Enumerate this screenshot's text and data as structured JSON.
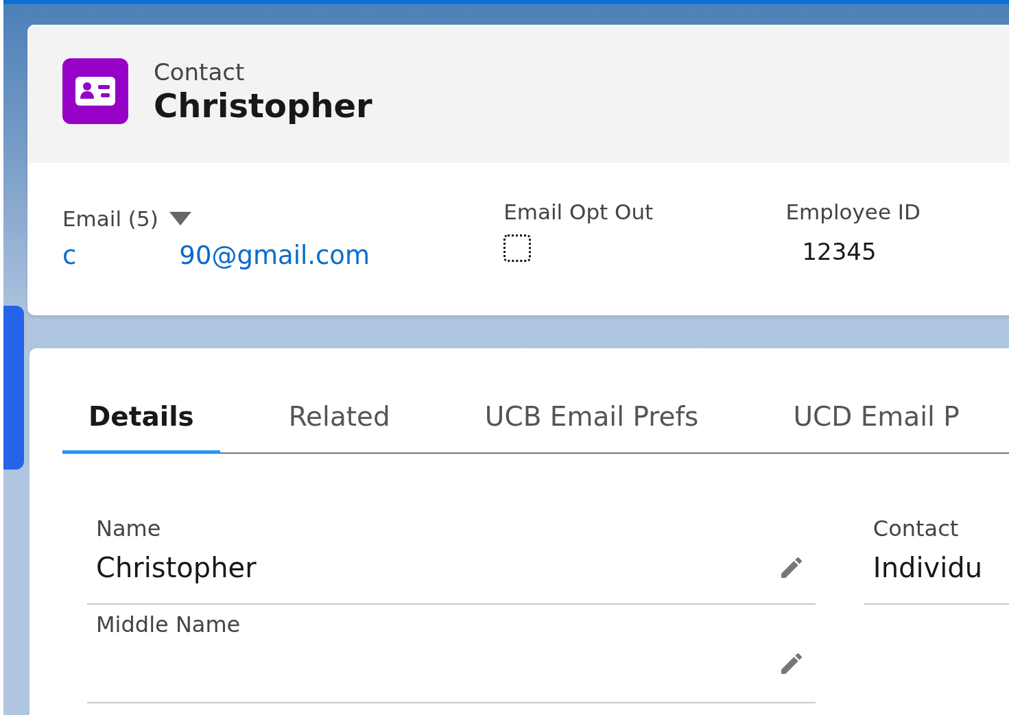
{
  "header": {
    "object_type": "Contact",
    "title": "Christopher"
  },
  "highlights": {
    "email": {
      "label": "Email (5)",
      "value_start": "c",
      "value_end": "90@gmail.com"
    },
    "email_opt_out": {
      "label": "Email Opt Out",
      "checked": false
    },
    "employee_id": {
      "label": "Employee ID",
      "value": "12345"
    }
  },
  "tabs": [
    {
      "label": "Details",
      "selected": true
    },
    {
      "label": "Related",
      "selected": false
    },
    {
      "label": "UCB Email Prefs",
      "selected": false
    },
    {
      "label": "UCD Email P",
      "selected": false
    }
  ],
  "fields": [
    {
      "label": "Name",
      "value": "Christopher"
    },
    {
      "label": "Middle Name"
    }
  ],
  "right_fields": [
    {
      "label": "Contact",
      "value": "Individu"
    }
  ]
}
